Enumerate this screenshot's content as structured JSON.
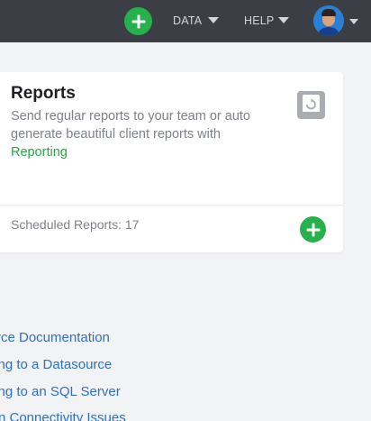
{
  "header": {
    "nav_data": "DATA",
    "nav_help": "HELP",
    "icons": {
      "add": "plus-circle-icon",
      "caret": "caret-down-icon",
      "avatar": "user-avatar"
    }
  },
  "colors": {
    "topbar": "#3b3e44",
    "accent_green": "#26b14c",
    "link_blue": "#2f6fc0",
    "background": "#f2f3f5"
  },
  "card": {
    "title": "Reports",
    "desc_line1": "Send regular reports to your team or auto",
    "desc_line2": "generate beautiful client reports with",
    "link_text": "Reporting",
    "stat": "Scheduled Reports: 17",
    "icon": "report-document-icon"
  },
  "doc_links": [
    {
      "text": "rce Documentation"
    },
    {
      "text": "ting to a Datasource"
    },
    {
      "text": "ting to an SQL Server"
    },
    {
      "text": "n Connectivity Issues"
    }
  ]
}
